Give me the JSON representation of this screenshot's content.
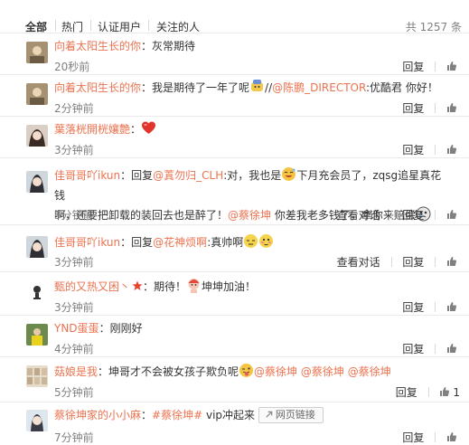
{
  "tabs": {
    "all": "全部",
    "hot": "热门",
    "verified": "认证用户",
    "following": "关注的人"
  },
  "total": "共 1257 条",
  "comments": [
    {
      "user": "向着太阳生长的你",
      "sep": "：",
      "text": "灰常期待",
      "time": "20秒前",
      "reply": "回复"
    },
    {
      "user": "向着太阳生长的你",
      "sep": "：",
      "text1": "我是期待了一年了呢",
      "text2": "//",
      "mention": "@陈鹏_DIRECTOR",
      "text3": ":优酷君 你好！",
      "time": "2分钟前",
      "reply": "回复"
    },
    {
      "user": "葉落桄開桄孃艶",
      "sep": "：",
      "time": "3分钟前",
      "reply": "回复"
    },
    {
      "user": "佳哥哥吖ikun",
      "sep": "：",
      "text1": "回复",
      "mention1": "@蒖勿归_CLH",
      "text2": ":对，我也是",
      "text3": "下月充会员了，zqsg追星真花钱",
      "text4": "啊，还要把卸载的装回去也是醉了！",
      "mention2": "@蔡徐坤",
      "text5": " 你差我老多钱了，拿你来赔偿",
      "time": "3分钟前",
      "view": "查看对话",
      "reply": "回复"
    },
    {
      "user": "佳哥哥吖ikun",
      "sep": "：",
      "text1": "回复",
      "mention": "@花神烦啊",
      "text2": ":真帅啊",
      "time": "3分钟前",
      "view": "查看对话",
      "reply": "回复"
    },
    {
      "user": "甄的又热又困丶",
      "sep": "：",
      "text1": "期待！",
      "text2": "坤坤加油！",
      "time": "3分钟前",
      "reply": "回复"
    },
    {
      "user": "YND蛋蛋",
      "sep": "：",
      "text": "刚刚好",
      "time": "4分钟前",
      "reply": "回复"
    },
    {
      "user": "菇娘是我",
      "sep": "：",
      "text1": "坤哥才不会被女孩子欺负呢",
      "mention1": "@蔡徐坤",
      "mention2": "@蔡徐坤",
      "mention3": "@蔡徐坤",
      "time": "5分钟前",
      "reply": "回复",
      "likes": "1"
    },
    {
      "user": "蔡徐坤家的小小麻",
      "sep": "：",
      "topic": "#蔡徐坤#",
      "text1": " vip冲起来",
      "link": "网页链接",
      "time": "7分钟前",
      "reply": "回复"
    }
  ]
}
